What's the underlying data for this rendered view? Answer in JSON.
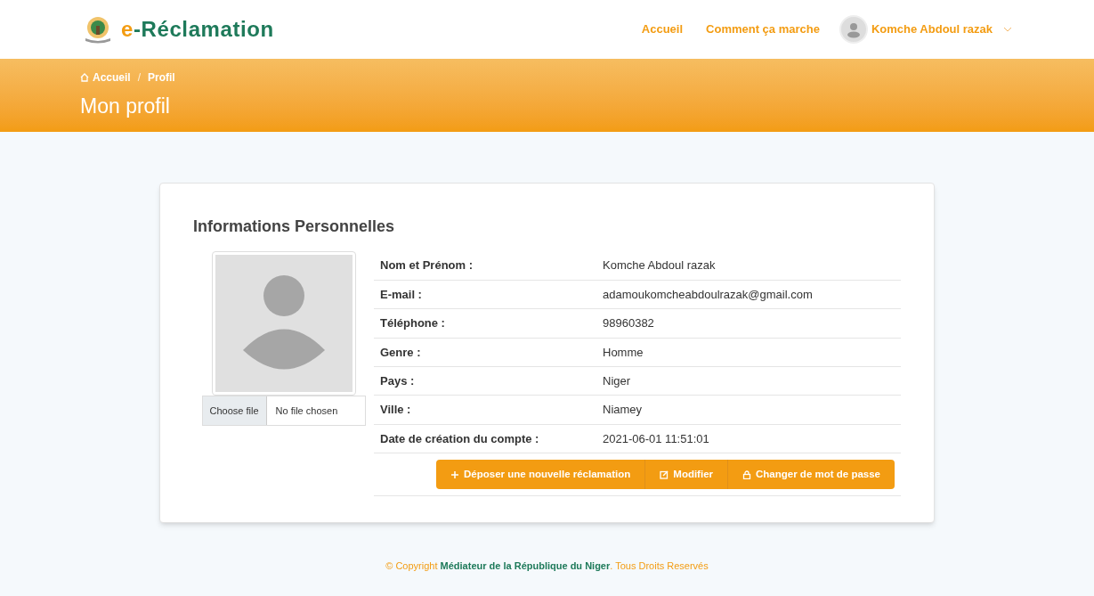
{
  "brand": {
    "prefix": "e",
    "rest": "-Réclamation"
  },
  "nav": [
    {
      "label": "Accueil"
    },
    {
      "label": "Comment ça marche"
    }
  ],
  "user_menu": {
    "name": "Komche Abdoul razak"
  },
  "breadcrumb": [
    {
      "label": "Accueil"
    },
    {
      "label": "Profil"
    }
  ],
  "breadcrumb_separator": "/",
  "page_title": "Mon profil",
  "card": {
    "title": "Informations Personnelles",
    "file_input": {
      "button": "Choose file",
      "status": "No file chosen"
    },
    "fields": [
      {
        "label": "Nom et Prénom :",
        "value": "Komche Abdoul razak"
      },
      {
        "label": "E-mail :",
        "value": "adamoukomcheabdoulrazak@gmail.com"
      },
      {
        "label": "Téléphone :",
        "value": "98960382"
      },
      {
        "label": "Genre :",
        "value": "Homme"
      },
      {
        "label": "Pays :",
        "value": "Niger"
      },
      {
        "label": "Ville :",
        "value": "Niamey"
      },
      {
        "label": "Date de création du compte :",
        "value": "2021-06-01 11:51:01"
      }
    ],
    "buttons": [
      {
        "label": "Déposer une nouvelle réclamation"
      },
      {
        "label": "Modifier"
      },
      {
        "label": "Changer de mot de passe"
      }
    ]
  },
  "footer": "© Copyright **Médiateur de la République du Niger**. Tous Droits Reservés"
}
